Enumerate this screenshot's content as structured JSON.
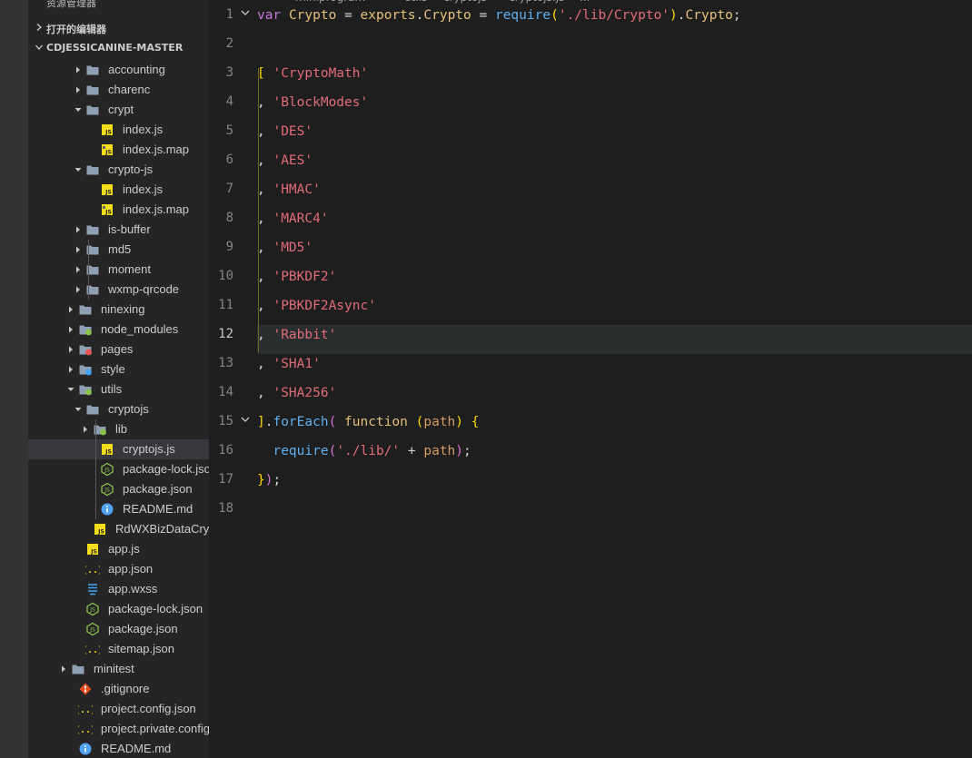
{
  "sidebar": {
    "title": "资源管理器",
    "more": "···",
    "open_editors": "打开的编辑器",
    "project": "CDJESSICANINE-MASTER"
  },
  "breadcrumb": [
    "miniprogram",
    "utils",
    "cryptojs",
    "cryptojs.js",
    "..."
  ],
  "tree": [
    {
      "name": "accounting",
      "type": "folder",
      "depth": 2,
      "expanded": false
    },
    {
      "name": "charenc",
      "type": "folder",
      "depth": 2,
      "expanded": false
    },
    {
      "name": "crypt",
      "type": "folder",
      "depth": 2,
      "expanded": true
    },
    {
      "name": "index.js",
      "type": "js",
      "depth": 3
    },
    {
      "name": "index.js.map",
      "type": "jsmap",
      "depth": 3
    },
    {
      "name": "crypto-js",
      "type": "folder",
      "depth": 2,
      "expanded": true
    },
    {
      "name": "index.js",
      "type": "js",
      "depth": 3
    },
    {
      "name": "index.js.map",
      "type": "jsmap",
      "depth": 3
    },
    {
      "name": "is-buffer",
      "type": "folder",
      "depth": 2,
      "expanded": false
    },
    {
      "name": "md5",
      "type": "folder",
      "depth": 2,
      "expanded": false
    },
    {
      "name": "moment",
      "type": "folder",
      "depth": 2,
      "expanded": false
    },
    {
      "name": "wxmp-qrcode",
      "type": "folder",
      "depth": 2,
      "expanded": false
    },
    {
      "name": "ninexing",
      "type": "folder",
      "depth": 1,
      "expanded": false
    },
    {
      "name": "node_modules",
      "type": "folder-node",
      "depth": 1,
      "expanded": false
    },
    {
      "name": "pages",
      "type": "folder-pages",
      "depth": 1,
      "expanded": false
    },
    {
      "name": "style",
      "type": "folder-style",
      "depth": 1,
      "expanded": false
    },
    {
      "name": "utils",
      "type": "folder-utils",
      "depth": 1,
      "expanded": true
    },
    {
      "name": "cryptojs",
      "type": "folder",
      "depth": 2,
      "expanded": true
    },
    {
      "name": "lib",
      "type": "folder-lib",
      "depth": 3,
      "expanded": false
    },
    {
      "name": "cryptojs.js",
      "type": "js",
      "depth": 3,
      "selected": true
    },
    {
      "name": "package-lock.json",
      "type": "npm",
      "depth": 3
    },
    {
      "name": "package.json",
      "type": "npm",
      "depth": 3
    },
    {
      "name": "README.md",
      "type": "info",
      "depth": 3
    },
    {
      "name": "RdWXBizDataCrypt.js",
      "type": "js",
      "depth": 2
    },
    {
      "name": "app.js",
      "type": "js",
      "depth": 1
    },
    {
      "name": "app.json",
      "type": "json",
      "depth": 1
    },
    {
      "name": "app.wxss",
      "type": "css",
      "depth": 1
    },
    {
      "name": "package-lock.json",
      "type": "npm",
      "depth": 1
    },
    {
      "name": "package.json",
      "type": "npm",
      "depth": 1
    },
    {
      "name": "sitemap.json",
      "type": "json",
      "depth": 1
    },
    {
      "name": "minitest",
      "type": "folder",
      "depth": 0,
      "expanded": false
    },
    {
      "name": ".gitignore",
      "type": "git",
      "depth": 0
    },
    {
      "name": "project.config.json",
      "type": "json",
      "depth": 0
    },
    {
      "name": "project.private.config.js...",
      "type": "json",
      "depth": 0
    },
    {
      "name": "README.md",
      "type": "info",
      "depth": 0
    }
  ],
  "editor": {
    "current_line": 12,
    "lines": [
      {
        "n": "1",
        "tokens": [
          [
            "kw",
            "var"
          ],
          [
            "plain",
            " "
          ],
          [
            "kw2",
            "Crypto"
          ],
          [
            "plain",
            " = "
          ],
          [
            "kw2",
            "exports"
          ],
          [
            "plain",
            "."
          ],
          [
            "kw2",
            "Crypto"
          ],
          [
            "plain",
            " = "
          ],
          [
            "fn",
            "require"
          ],
          [
            "br1",
            "("
          ],
          [
            "str",
            "'./lib/Crypto'"
          ],
          [
            "br1",
            ")"
          ],
          [
            "plain",
            "."
          ],
          [
            "kw2",
            "Crypto"
          ],
          [
            "plain",
            ";"
          ]
        ]
      },
      {
        "n": "2",
        "tokens": []
      },
      {
        "n": "3",
        "tokens": [
          [
            "br1",
            "["
          ],
          [
            "plain",
            " "
          ],
          [
            "str",
            "'CryptoMath'"
          ]
        ]
      },
      {
        "n": "4",
        "tokens": [
          [
            "plain",
            ", "
          ],
          [
            "str",
            "'BlockModes'"
          ]
        ]
      },
      {
        "n": "5",
        "tokens": [
          [
            "plain",
            ", "
          ],
          [
            "str",
            "'DES'"
          ]
        ]
      },
      {
        "n": "6",
        "tokens": [
          [
            "plain",
            ", "
          ],
          [
            "str",
            "'AES'"
          ]
        ]
      },
      {
        "n": "7",
        "tokens": [
          [
            "plain",
            ", "
          ],
          [
            "str",
            "'HMAC'"
          ]
        ]
      },
      {
        "n": "8",
        "tokens": [
          [
            "plain",
            ", "
          ],
          [
            "str",
            "'MARC4'"
          ]
        ]
      },
      {
        "n": "9",
        "tokens": [
          [
            "plain",
            ", "
          ],
          [
            "str",
            "'MD5'"
          ]
        ]
      },
      {
        "n": "10",
        "tokens": [
          [
            "plain",
            ", "
          ],
          [
            "str",
            "'PBKDF2'"
          ]
        ]
      },
      {
        "n": "11",
        "tokens": [
          [
            "plain",
            ", "
          ],
          [
            "str",
            "'PBKDF2Async'"
          ]
        ]
      },
      {
        "n": "12",
        "tokens": [
          [
            "plain",
            ", "
          ],
          [
            "str",
            "'Rabbit'"
          ]
        ]
      },
      {
        "n": "13",
        "tokens": [
          [
            "plain",
            ", "
          ],
          [
            "str",
            "'SHA1'"
          ]
        ]
      },
      {
        "n": "14",
        "tokens": [
          [
            "plain",
            ", "
          ],
          [
            "str",
            "'SHA256'"
          ]
        ]
      },
      {
        "n": "15",
        "tokens": [
          [
            "br1",
            "]"
          ],
          [
            "plain",
            "."
          ],
          [
            "fn",
            "forEach"
          ],
          [
            "br2",
            "("
          ],
          [
            "plain",
            " "
          ],
          [
            "kw2",
            "function"
          ],
          [
            "plain",
            " "
          ],
          [
            "br1",
            "("
          ],
          [
            "par",
            "path"
          ],
          [
            "br1",
            ")"
          ],
          [
            "plain",
            " "
          ],
          [
            "br1",
            "{"
          ]
        ]
      },
      {
        "n": "16",
        "tokens": [
          [
            "plain",
            "  "
          ],
          [
            "fn",
            "require"
          ],
          [
            "br2",
            "("
          ],
          [
            "str",
            "'./lib/'"
          ],
          [
            "plain",
            " + "
          ],
          [
            "par",
            "path"
          ],
          [
            "br2",
            ")"
          ],
          [
            "plain",
            ";"
          ]
        ]
      },
      {
        "n": "17",
        "tokens": [
          [
            "br1",
            "}"
          ],
          [
            "br2",
            ")"
          ],
          [
            "plain",
            ";"
          ]
        ]
      },
      {
        "n": "18",
        "tokens": []
      }
    ]
  },
  "colors": {
    "folder": "#dcb67a",
    "js": "#f5de19",
    "npm": "#8bc34a",
    "info": "#4fa3f7",
    "css": "#42a5f5",
    "git": "#e64a19",
    "node": "#8bc34a",
    "pages": "#ef5350",
    "style": "#42a5f5"
  }
}
